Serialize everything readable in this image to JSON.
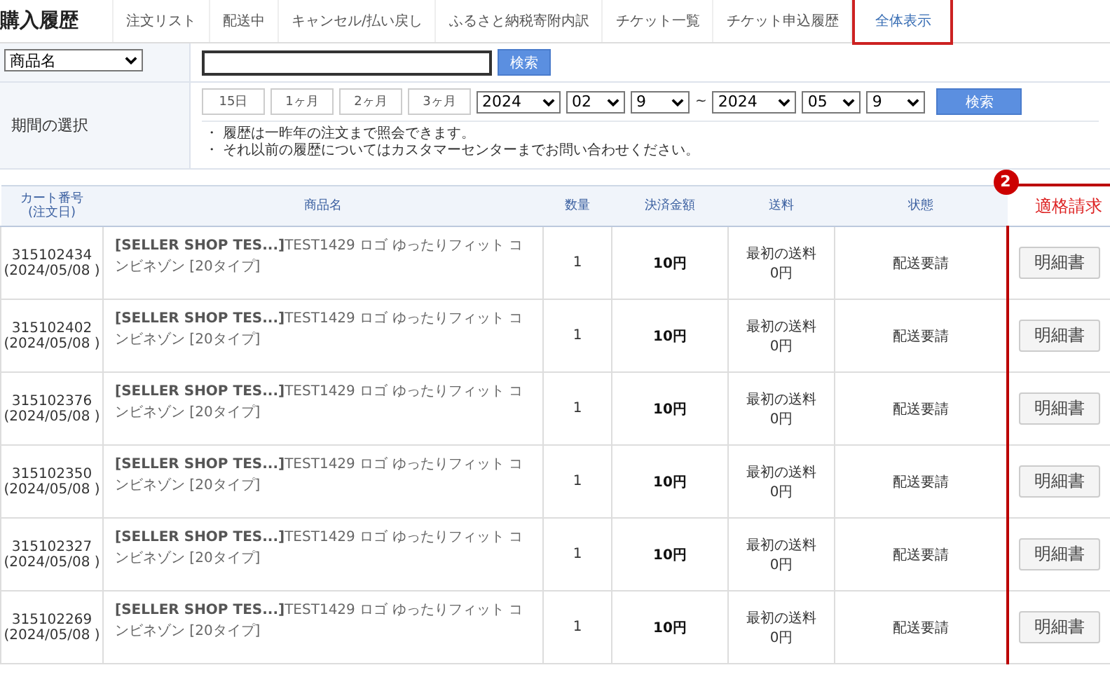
{
  "page_title": "購入履歴",
  "tabs": [
    {
      "label": "注文リスト",
      "selected": false
    },
    {
      "label": "配送中",
      "selected": false
    },
    {
      "label": "キャンセル/払い戻し",
      "selected": false
    },
    {
      "label": "ふるさと納税寄附内訳",
      "selected": false
    },
    {
      "label": "チケット一覧",
      "selected": false
    },
    {
      "label": "チケット申込履歴",
      "selected": false
    },
    {
      "label": "全体表示",
      "selected": true
    }
  ],
  "search": {
    "field_select": "商品名",
    "button": "検索"
  },
  "period": {
    "label": "期間の選択",
    "quick_buttons": [
      "15日",
      "1ヶ月",
      "2ヶ月",
      "3ヶ月"
    ],
    "from": [
      "2024",
      "02",
      "9"
    ],
    "separator": "~",
    "to": [
      "2024",
      "05",
      "9"
    ],
    "button": "検索",
    "notes": [
      "・ 履歴は一昨年の注文まで照会できます。",
      "・ それ以前の履歴についてはカスタマーセンターまでお問い合わせください。"
    ]
  },
  "table": {
    "columns": [
      "カート番号\n(注文日)",
      "商品名",
      "数量",
      "決済金額",
      "送料",
      "状態",
      "適格請求"
    ],
    "annotation": "2",
    "rows": [
      {
        "cart": "315102434",
        "date": "(2024/05/08 )",
        "brand": "[SELLER SHOP TES...]",
        "product": "TEST1429 ロゴ ゆったりフィット コンビネゾン [20タイプ]",
        "qty": "1",
        "amount": "10円",
        "shipping": [
          "最初の送料",
          "0円"
        ],
        "status": "配送要請",
        "button": "明細書"
      },
      {
        "cart": "315102402",
        "date": "(2024/05/08 )",
        "brand": "[SELLER SHOP TES...]",
        "product": "TEST1429 ロゴ ゆったりフィット コンビネゾン [20タイプ]",
        "qty": "1",
        "amount": "10円",
        "shipping": [
          "最初の送料",
          "0円"
        ],
        "status": "配送要請",
        "button": "明細書"
      },
      {
        "cart": "315102376",
        "date": "(2024/05/08 )",
        "brand": "[SELLER SHOP TES...]",
        "product": "TEST1429 ロゴ ゆったりフィット コンビネゾン [20タイプ]",
        "qty": "1",
        "amount": "10円",
        "shipping": [
          "最初の送料",
          "0円"
        ],
        "status": "配送要請",
        "button": "明細書"
      },
      {
        "cart": "315102350",
        "date": "(2024/05/08 )",
        "brand": "[SELLER SHOP TES...]",
        "product": "TEST1429 ロゴ ゆったりフィット コンビネゾン [20タイプ]",
        "qty": "1",
        "amount": "10円",
        "shipping": [
          "最初の送料",
          "0円"
        ],
        "status": "配送要請",
        "button": "明細書"
      },
      {
        "cart": "315102327",
        "date": "(2024/05/08 )",
        "brand": "[SELLER SHOP TES...]",
        "product": "TEST1429 ロゴ ゆったりフィット コンビネゾン [20タイプ]",
        "qty": "1",
        "amount": "10円",
        "shipping": [
          "最初の送料",
          "0円"
        ],
        "status": "配送要請",
        "button": "明細書"
      },
      {
        "cart": "315102269",
        "date": "(2024/05/08 )",
        "brand": "[SELLER SHOP TES...]",
        "product": "TEST1429 ロゴ ゆったりフィット コンビネゾン [20タイプ]",
        "qty": "1",
        "amount": "10円",
        "shipping": [
          "最初の送料",
          "0円"
        ],
        "status": "配送要請",
        "button": "明細書"
      }
    ]
  }
}
